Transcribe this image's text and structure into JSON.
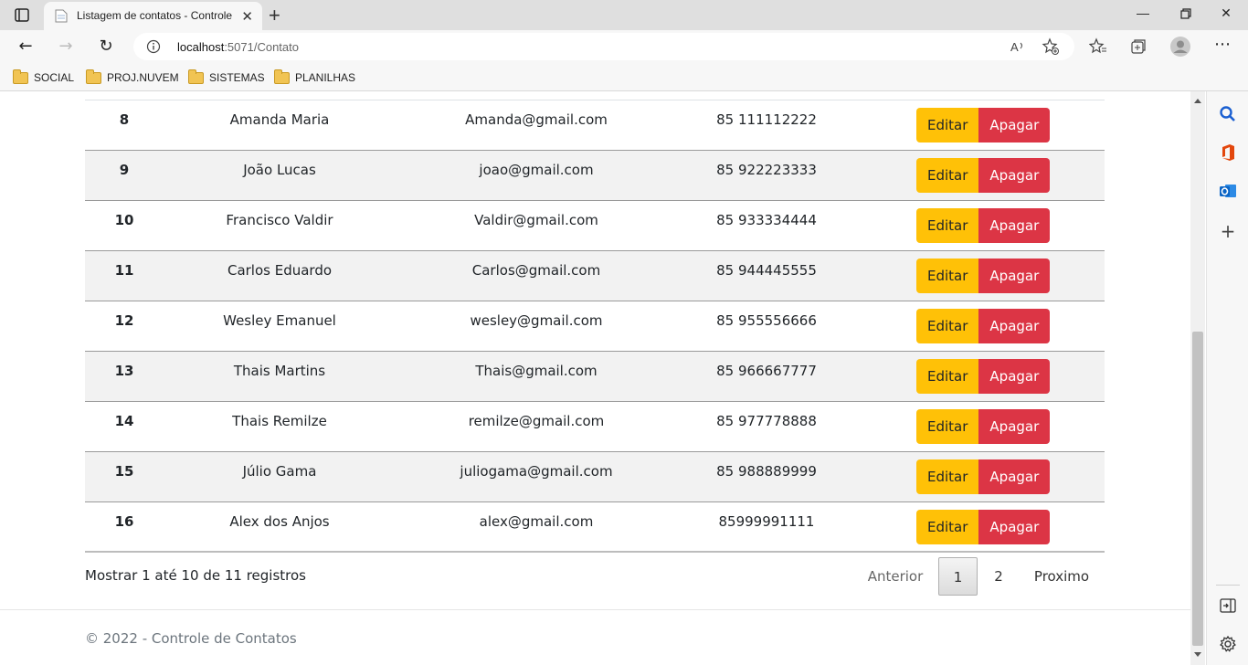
{
  "browser": {
    "tab_title": "Listagem de contatos - Controle",
    "url_host": "localhost",
    "url_rest": ":5071/Contato",
    "bookmarks": [
      "SOCIAL",
      "PROJ.NUVEM",
      "SISTEMAS",
      "PLANILHAS"
    ]
  },
  "table": {
    "rows": [
      {
        "id": "8",
        "name": "Amanda Maria",
        "email": "Amanda@gmail.com",
        "phone": "85 111112222"
      },
      {
        "id": "9",
        "name": "João Lucas",
        "email": "joao@gmail.com",
        "phone": "85 922223333"
      },
      {
        "id": "10",
        "name": "Francisco Valdir",
        "email": "Valdir@gmail.com",
        "phone": "85 933334444"
      },
      {
        "id": "11",
        "name": "Carlos Eduardo",
        "email": "Carlos@gmail.com",
        "phone": "85 944445555"
      },
      {
        "id": "12",
        "name": "Wesley Emanuel",
        "email": "wesley@gmail.com",
        "phone": "85 955556666"
      },
      {
        "id": "13",
        "name": "Thais Martins",
        "email": "Thais@gmail.com",
        "phone": "85 966667777"
      },
      {
        "id": "14",
        "name": "Thais Remilze",
        "email": "remilze@gmail.com",
        "phone": "85 977778888"
      },
      {
        "id": "15",
        "name": "Júlio Gama",
        "email": "juliogama@gmail.com",
        "phone": "85 988889999"
      },
      {
        "id": "16",
        "name": "Alex dos Anjos",
        "email": "alex@gmail.com",
        "phone": "85999991111"
      }
    ],
    "edit_label": "Editar",
    "delete_label": "Apagar"
  },
  "pagination": {
    "info": "Mostrar 1 até 10 de 11 registros",
    "prev": "Anterior",
    "pages": [
      "1",
      "2"
    ],
    "next": "Proximo",
    "current": "1"
  },
  "footer": {
    "copyright": "© 2022 - Controle de Contatos"
  },
  "colors": {
    "edit": "#ffc107",
    "delete": "#dc3545"
  }
}
